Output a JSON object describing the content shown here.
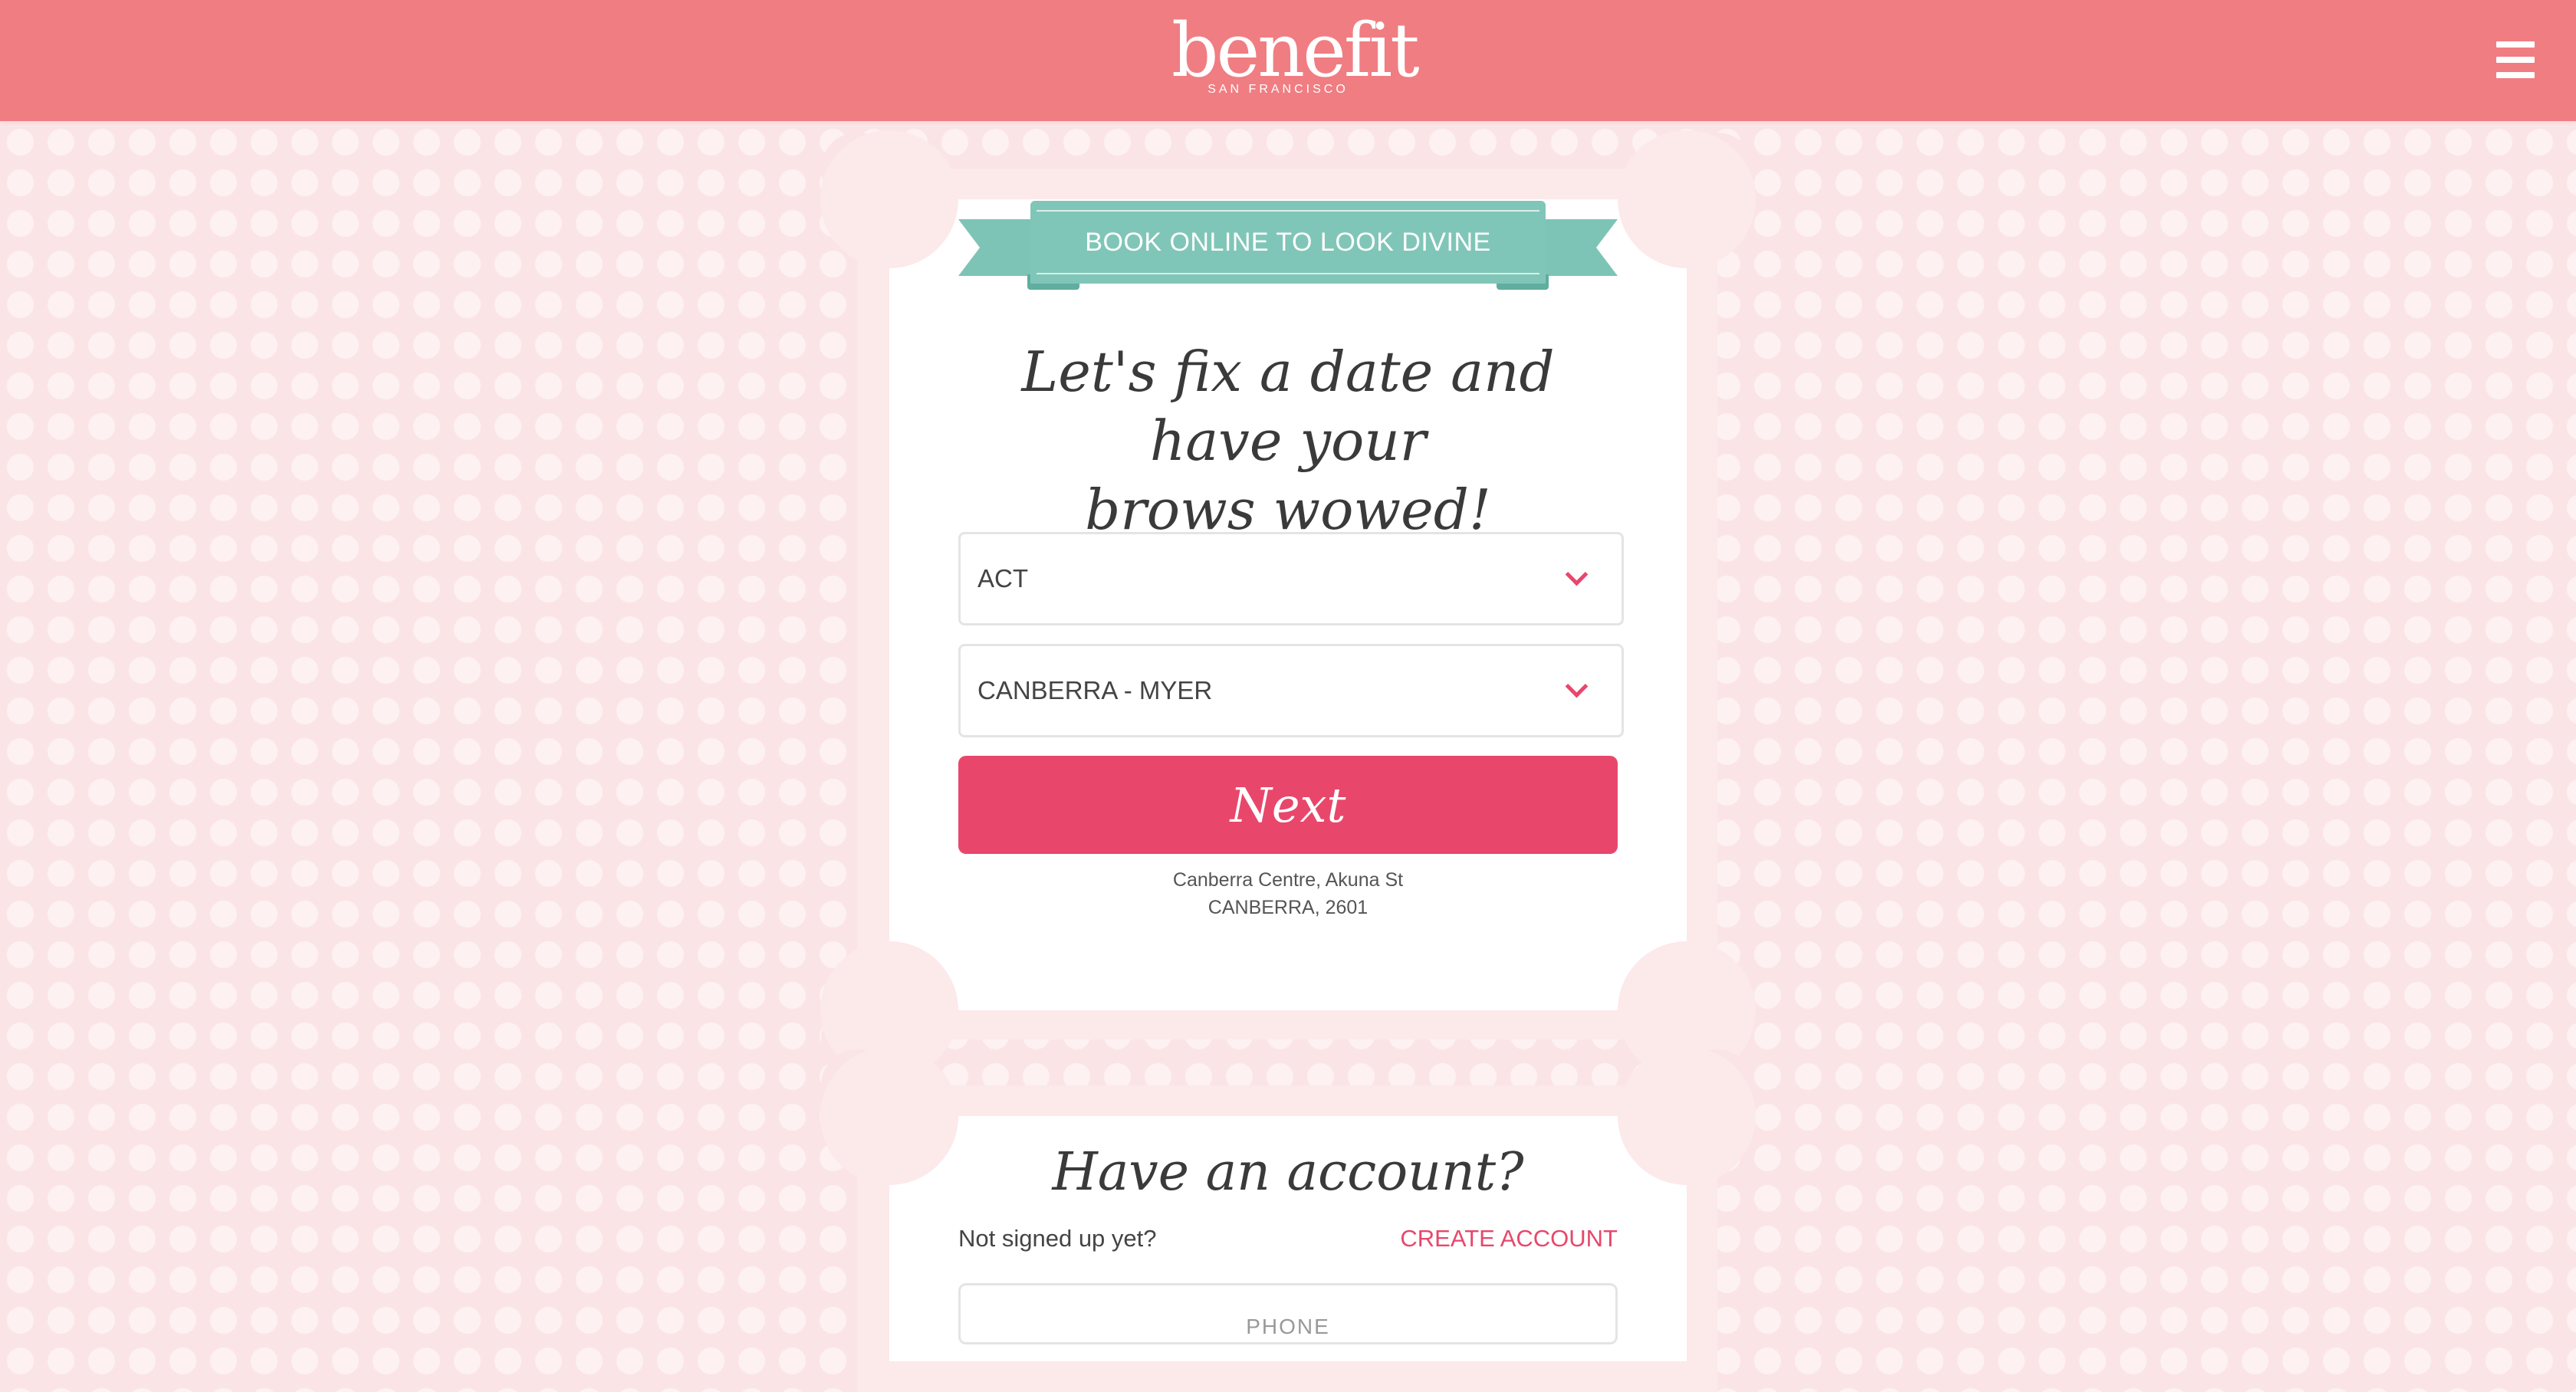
{
  "header": {
    "brand_name": "benefit",
    "brand_tagline": "SAN FRANCISCO",
    "menu_icon": "hamburger-menu-icon",
    "background_color": "#f07d82"
  },
  "booking": {
    "banner_text": "BOOK ONLINE TO LOOK DIVINE",
    "headline_line1": "Let's fix a date and have your",
    "headline_line2": "brows wowed!",
    "state_select": {
      "value": "ACT",
      "icon": "chevron-down-icon"
    },
    "store_select": {
      "value": "CANBERRA - MYER",
      "icon": "chevron-down-icon"
    },
    "next_label": "Next",
    "address_line1": "Canberra Centre, Akuna St",
    "address_line2": "CANBERRA, 2601"
  },
  "account": {
    "title": "Have an account?",
    "not_signed_up": "Not signed up yet?",
    "create_account": "CREATE ACCOUNT",
    "phone_placeholder": "PHONE"
  },
  "colors": {
    "accent_pink": "#e8476b",
    "banner_teal": "#80c6b8",
    "page_background": "#fbe4e6"
  }
}
